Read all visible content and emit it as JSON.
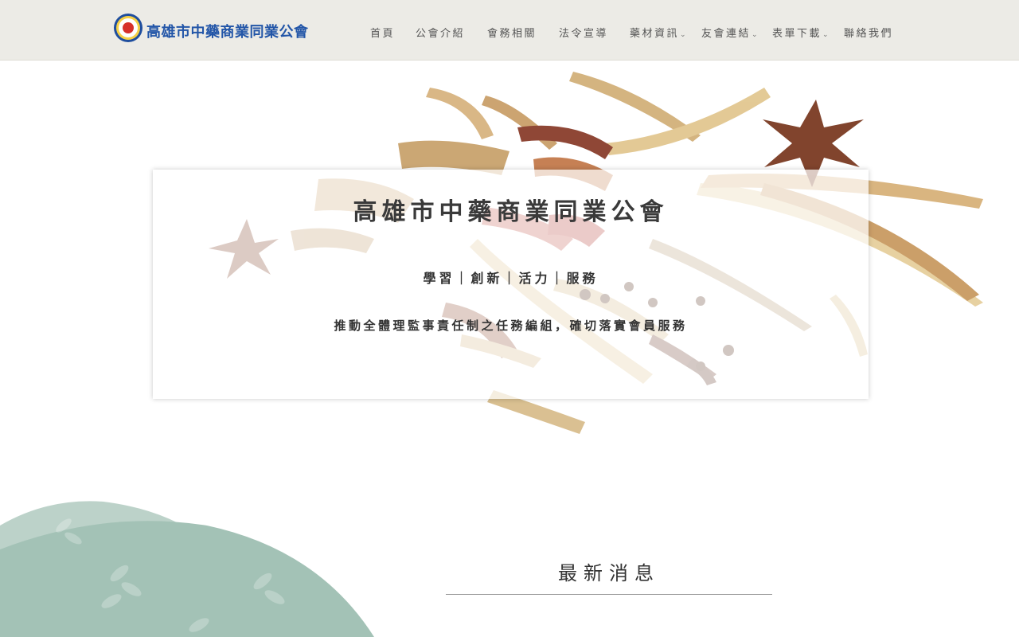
{
  "brand": {
    "name": "高雄市中藥商業同業公會"
  },
  "nav": [
    {
      "label": "首頁",
      "has_dropdown": false
    },
    {
      "label": "公會介紹",
      "has_dropdown": false
    },
    {
      "label": "會務相關",
      "has_dropdown": false
    },
    {
      "label": "法令宣導",
      "has_dropdown": false
    },
    {
      "label": "藥材資訊",
      "has_dropdown": true
    },
    {
      "label": "友會連結",
      "has_dropdown": true
    },
    {
      "label": "表單下載",
      "has_dropdown": true
    },
    {
      "label": "聯絡我們",
      "has_dropdown": false
    }
  ],
  "hero": {
    "title": "高雄市中藥商業同業公會",
    "tagline": "學習｜創新｜活力｜服務",
    "description": "推動全體理監事責任制之任務編組，確切落實會員服務"
  },
  "news": {
    "title": "最新消息"
  },
  "colors": {
    "header_bg": "#ecebe6",
    "brand_blue": "#2356a8",
    "deco_green_light": "#bcd2c9",
    "deco_green_dark": "#a3c2b6"
  },
  "icons": {
    "logo": "association-emblem-icon",
    "dropdown": "chevron-down-icon"
  }
}
